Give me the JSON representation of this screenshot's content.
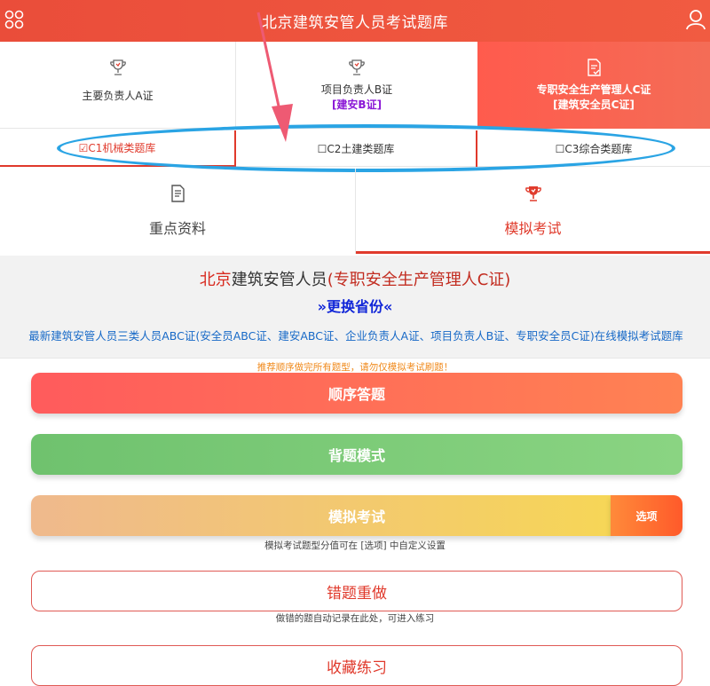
{
  "header": {
    "title": "北京建筑安管人员考试题库",
    "menu_icon": "grid-menu-icon",
    "user_icon": "user-icon"
  },
  "cert_tabs": [
    {
      "label": "主要负责人A证",
      "sub": "",
      "icon": "trophy-icon"
    },
    {
      "label": "项目负责人B证",
      "sub": "[建安B证]",
      "icon": "trophy-icon"
    },
    {
      "label": "专职安全生产管理人C证",
      "sub": "[建筑安全员C证]",
      "icon": "document-check-icon"
    }
  ],
  "sub_tabs": [
    {
      "label": "☑C1机械类题库"
    },
    {
      "label": "☐C2土建类题库"
    },
    {
      "label": "☐C3综合类题库"
    }
  ],
  "mode_tabs": [
    {
      "label": "重点资料",
      "icon": "document-icon"
    },
    {
      "label": "模拟考试",
      "icon": "trophy-icon"
    }
  ],
  "info": {
    "city": "北京",
    "title_mid": "建筑安管人员",
    "cert": "(专职安全生产管理人C证)",
    "switch": "»更换省份«",
    "desc": "最新建筑安管人员三类人员ABC证(安全员ABC证、建安ABC证、企业负责人A证、项目负责人B证、专职安全员C证)在线模拟考试题库"
  },
  "hint": "推荐顺序做完所有题型，请勿仅模拟考试刷题！",
  "buttons": {
    "sequence": "顺序答题",
    "memorize": "背题模式",
    "exam": "模拟考试",
    "options": "选项",
    "exam_note": "模拟考试题型分值可在 [选项] 中自定义设置",
    "wrong": "错题重做",
    "wrong_note": "做错的题自动记录在此处，可进入练习",
    "favorite": "收藏练习"
  },
  "colors": {
    "accent": "#e0392b",
    "header": "#ea4d3a",
    "annotation": "#2aa4e4",
    "link": "#1769c7"
  }
}
